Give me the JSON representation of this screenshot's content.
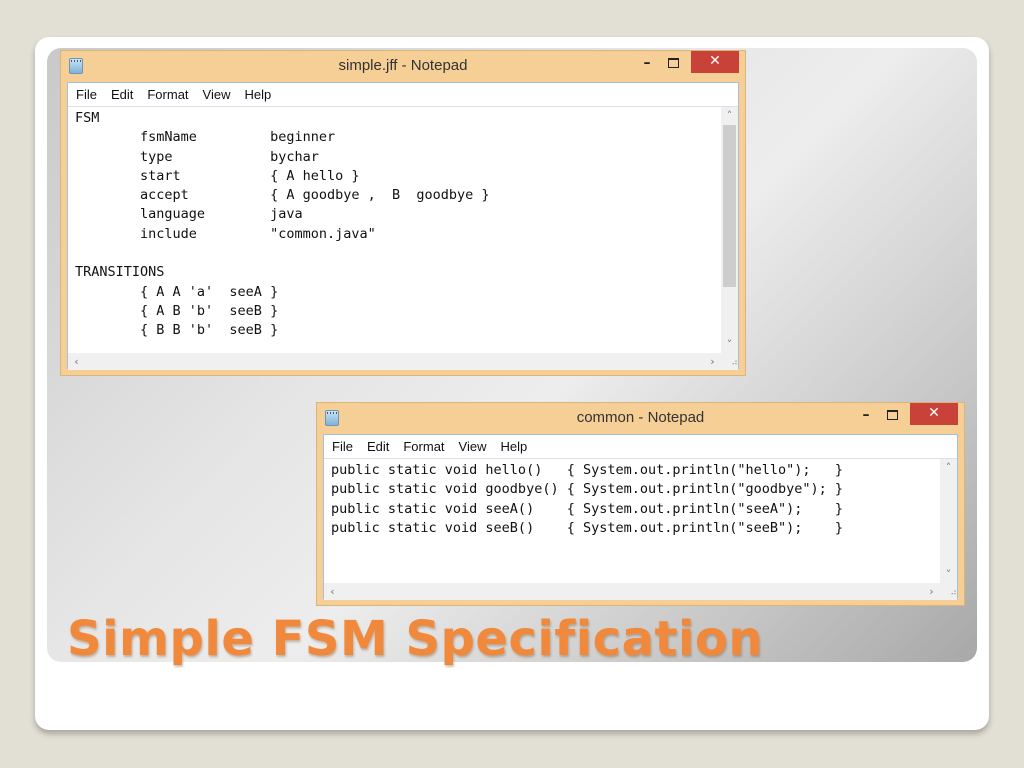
{
  "slide": {
    "title": "Simple FSM Specification",
    "title_color": "#f0893c"
  },
  "windows": [
    {
      "title": "simple.jff - Notepad",
      "icon": "notepad-icon",
      "controls": {
        "minimize": "–",
        "maximize": "□",
        "close": "✕"
      },
      "menu": [
        {
          "label": "File",
          "accel": "F"
        },
        {
          "label": "Edit",
          "accel": "E"
        },
        {
          "label": "Format",
          "accel": "o"
        },
        {
          "label": "View",
          "accel": "V"
        },
        {
          "label": "Help",
          "accel": "H"
        }
      ],
      "lines": [
        "FSM",
        "        fsmName         beginner",
        "        type            bychar",
        "        start           { A hello }",
        "        accept          { A goodbye ,  B  goodbye }",
        "        language        java",
        "        include         \"common.java\"",
        "",
        "TRANSITIONS",
        "        { A A 'a'  seeA }",
        "        { A B 'b'  seeB }",
        "        { B B 'b'  seeB }"
      ]
    },
    {
      "title": "common - Notepad",
      "icon": "notepad-icon",
      "controls": {
        "minimize": "–",
        "maximize": "□",
        "close": "✕"
      },
      "menu": [
        {
          "label": "File",
          "accel": "F"
        },
        {
          "label": "Edit",
          "accel": "E"
        },
        {
          "label": "Format",
          "accel": "o"
        },
        {
          "label": "View",
          "accel": "V"
        },
        {
          "label": "Help",
          "accel": "H"
        }
      ],
      "lines": [
        "public static void hello()   { System.out.println(\"hello\");   }",
        "public static void goodbye() { System.out.println(\"goodbye\"); }",
        "public static void seeA()    { System.out.println(\"seeA\");    }",
        "public static void seeB()    { System.out.println(\"seeB\");    }"
      ]
    }
  ],
  "scroll_glyphs": {
    "up": "˄",
    "down": "˅",
    "left": "‹",
    "right": "›",
    "grip": "⠴"
  }
}
